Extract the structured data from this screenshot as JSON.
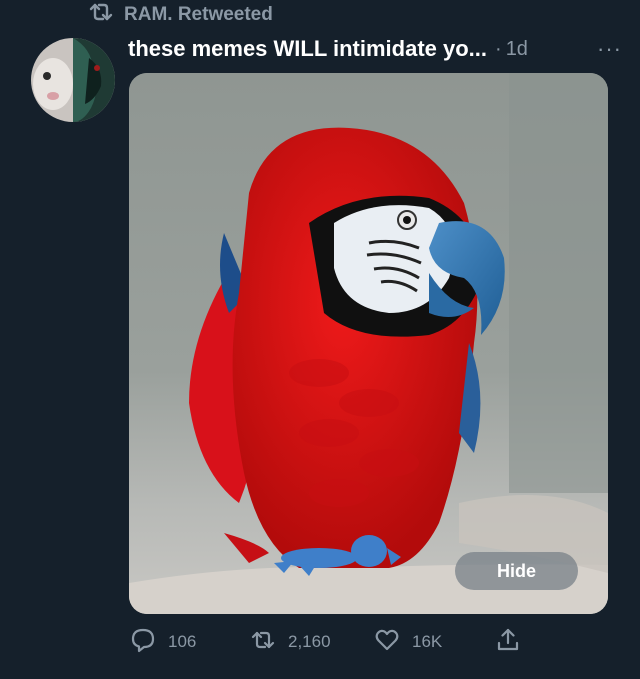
{
  "retweet": {
    "label": "RAM. Retweeted",
    "icon": "retweet-icon"
  },
  "tweet": {
    "text": "these memes WILL intimidate yo...",
    "separator": "·",
    "time": "1d",
    "more": "···"
  },
  "media": {
    "subject": "red macaw parrot photo",
    "hide_label": "Hide"
  },
  "actions": {
    "replies": "106",
    "retweets": "2,160",
    "likes": "16K"
  },
  "colors": {
    "background": "#15202b",
    "secondary_text": "#8b98a5",
    "primary_text": "#ffffff"
  }
}
